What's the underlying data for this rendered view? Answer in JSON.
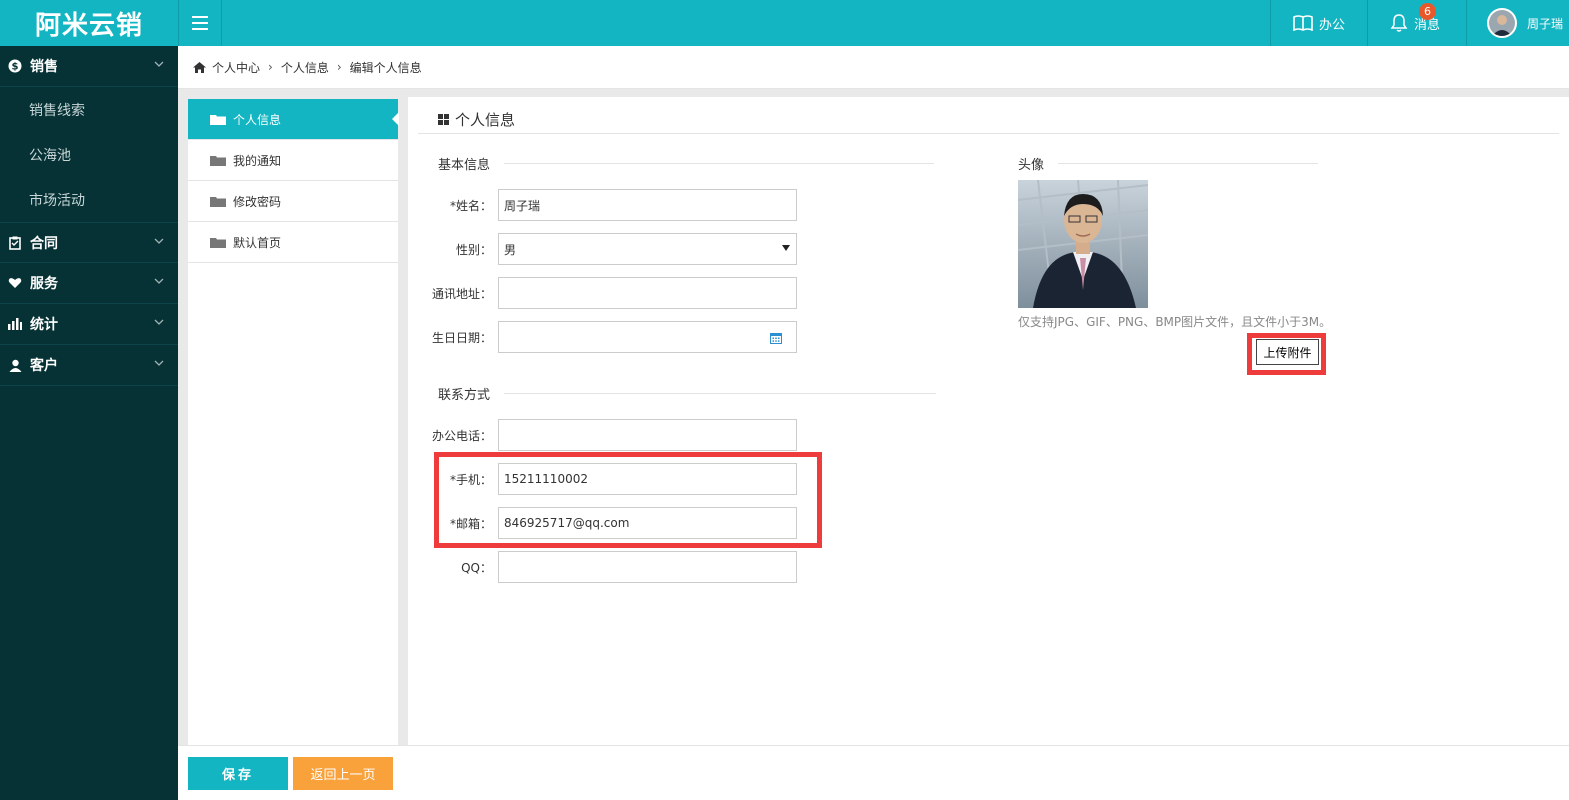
{
  "header": {
    "logo_text": "阿米云销",
    "office_label": "办公",
    "messages_label": "消息",
    "messages_count": "6",
    "user_name": "周子瑞"
  },
  "sidebar": {
    "sales": "销售",
    "sales_items": [
      "销售线索",
      "公海池",
      "市场活动"
    ],
    "contract": "合同",
    "service": "服务",
    "stats": "统计",
    "customer": "客户"
  },
  "breadcrumb": [
    "个人中心",
    "个人信息",
    "编辑个人信息"
  ],
  "left_menu": [
    "个人信息",
    "我的通知",
    "修改密码",
    "默认首页"
  ],
  "main": {
    "title": "个人信息",
    "basic_section": "基本信息",
    "contact_section": "联系方式",
    "avatar_section": "头像"
  },
  "form": {
    "name_label": "*姓名：",
    "name_value": "周子瑞",
    "gender_label": "性别：",
    "gender_value": "男",
    "address_label": "通讯地址：",
    "address_value": "",
    "birthday_label": "生日日期：",
    "birthday_value": "",
    "office_phone_label": "办公电话：",
    "office_phone_value": "",
    "mobile_label": "*手机：",
    "mobile_value": "15211110002",
    "email_label": "*邮箱：",
    "email_value": "846925717@qq.com",
    "qq_label": "QQ：",
    "qq_value": ""
  },
  "avatar": {
    "hint": "仅支持JPG、GIF、PNG、BMP图片文件，且文件小于3M。",
    "upload_label": "上传附件"
  },
  "footer": {
    "save_label": "保存",
    "back_label": "返回上一页"
  },
  "colors": {
    "accent": "#12b5c1",
    "sidebar_bg": "#063236",
    "back_button": "#f9a13b",
    "highlight": "#ee3b3b",
    "badge": "#e8582a"
  }
}
